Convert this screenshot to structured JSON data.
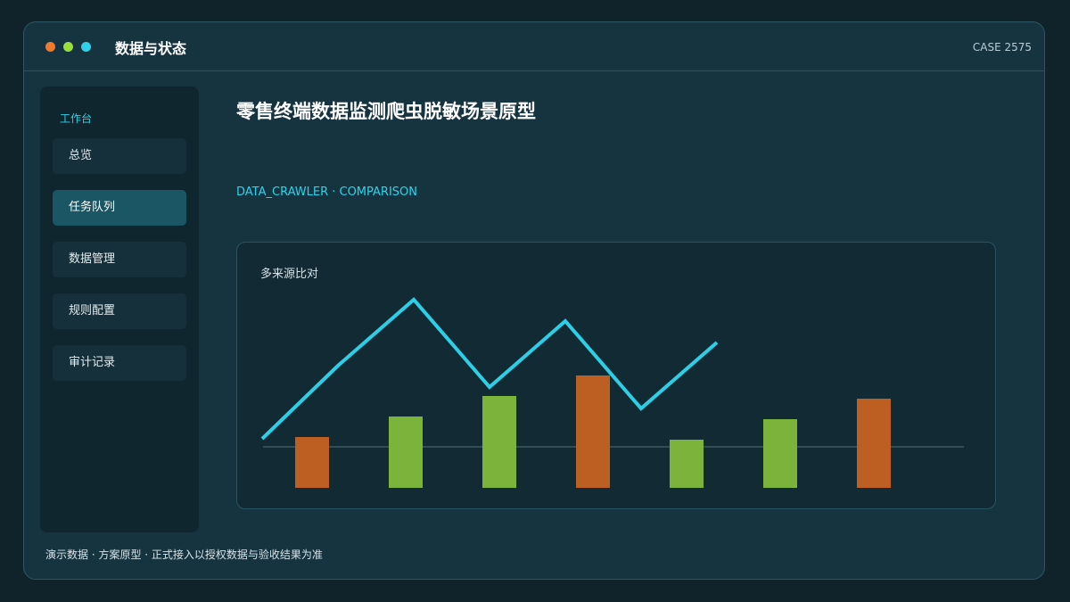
{
  "window": {
    "title": "数据与状态",
    "case_id": "CASE 2575"
  },
  "sidebar": {
    "heading": "工作台",
    "items": [
      {
        "label": "总览",
        "active": false
      },
      {
        "label": "任务队列",
        "active": true
      },
      {
        "label": "数据管理",
        "active": false
      },
      {
        "label": "规则配置",
        "active": false
      },
      {
        "label": "审计记录",
        "active": false
      }
    ]
  },
  "main": {
    "title": "零售终端数据监测爬虫脱敏场景原型",
    "subtitle": "DATA_CRAWLER · COMPARISON"
  },
  "chart_data": {
    "type": "bar",
    "title": "多来源比对",
    "bar_values": [
      57,
      80,
      103,
      126,
      54,
      77,
      100
    ],
    "bar_colors": [
      "#bd5f22",
      "#7cb33a",
      "#7cb33a",
      "#bd5f22",
      "#7cb33a",
      "#7cb33a",
      "#bd5f22"
    ],
    "line_values": [
      55,
      137,
      211,
      113,
      187,
      89,
      163
    ],
    "line_color": "#2ccfe6"
  },
  "footer": {
    "note": "演示数据 · 方案原型 · 正式接入以授权数据与验收结果为准"
  }
}
